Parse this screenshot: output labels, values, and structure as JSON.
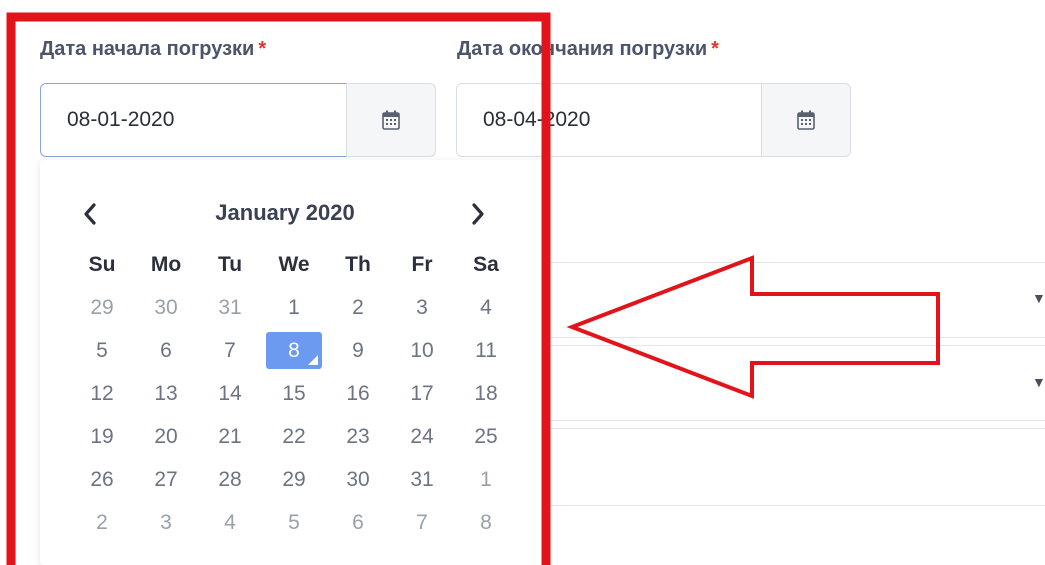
{
  "form": {
    "start_label": "Дата начала погрузки",
    "end_label": "Дата окончания погрузки",
    "required_mark": "*",
    "start_value": "08-01-2020",
    "end_value": "08-04-2020"
  },
  "datepicker": {
    "month_title": "January 2020",
    "prev": "‹",
    "next": "›",
    "weekdays": [
      "Su",
      "Mo",
      "Tu",
      "We",
      "Th",
      "Fr",
      "Sa"
    ],
    "weeks": [
      [
        "29",
        "30",
        "31",
        "1",
        "2",
        "3",
        "4"
      ],
      [
        "5",
        "6",
        "7",
        "8",
        "9",
        "10",
        "11"
      ],
      [
        "12",
        "13",
        "14",
        "15",
        "16",
        "17",
        "18"
      ],
      [
        "19",
        "20",
        "21",
        "22",
        "23",
        "24",
        "25"
      ],
      [
        "26",
        "27",
        "28",
        "29",
        "30",
        "31",
        "1"
      ],
      [
        "2",
        "3",
        "4",
        "5",
        "6",
        "7",
        "8"
      ]
    ],
    "selected": "8"
  },
  "dropdowns": [
    {
      "caret": "▼"
    },
    {
      "caret": "▼"
    }
  ],
  "colors": {
    "annotation": "#e3131c",
    "selected_day": "#6b9af0",
    "required": "#e3342f"
  }
}
